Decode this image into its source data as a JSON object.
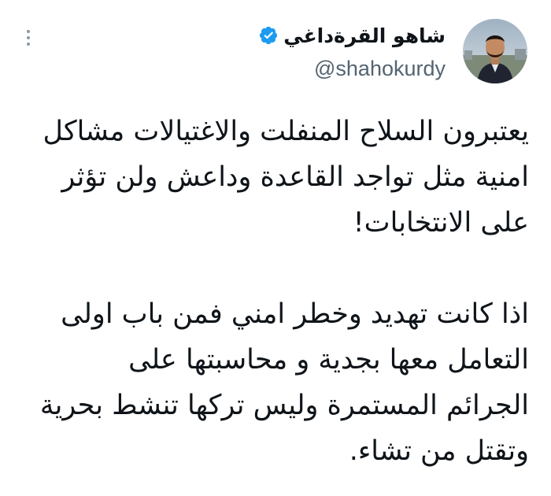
{
  "user": {
    "display_name": "شاهو القرةداغي",
    "handle": "@shahokurdy",
    "verified": true
  },
  "icons": {
    "verified": "verified-badge-icon",
    "more": "more-options-icon"
  },
  "colors": {
    "verified_blue": "#1d9bf0",
    "handle_gray": "#536471",
    "text": "#0f1419"
  },
  "tweet": {
    "paragraph_1": [
      "يعتبرون السلاح المنفلت والاغتيالات مشاكل",
      "امنية مثل تواجد القاعدة وداعش ولن تؤثر",
      "على الانتخابات!"
    ],
    "paragraph_2": [
      "اذا كانت تهديد وخطر امني فمن باب اولى",
      "التعامل معها بجدية و محاسبتها على",
      "الجرائم المستمرة وليس تركها تنشط بحرية",
      "وتقتل من تشاء."
    ]
  }
}
